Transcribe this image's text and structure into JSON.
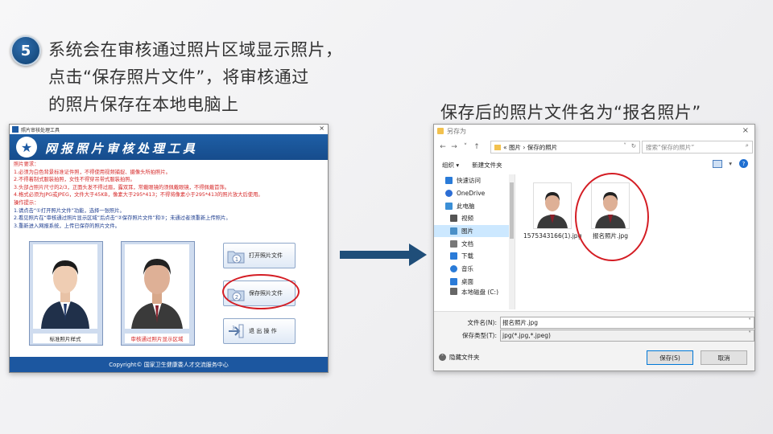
{
  "step": {
    "number": "5",
    "lines": [
      "系统会在审核通过照片区域显示照片，",
      "点击“保存照片文件”，将审核通过",
      "的照片保存在本地电脑上"
    ]
  },
  "caption_right": "保存后的照片文件名为“报名照片”",
  "tool_window": {
    "title": "照片审核处理工具",
    "close": "×",
    "banner_title": "网报照片审核处理工具",
    "requirements": [
      {
        "text": "照片要求：",
        "color": "red"
      },
      {
        "text": "1.必须为白色背景标准证件照，不得使用视频捕捉、摄像头所拍照片。",
        "color": "red"
      },
      {
        "text": "2.不得着制式服装拍照，女性不得穿吊带式服装拍照。",
        "color": "red"
      },
      {
        "text": "3.头部占照片尺寸的2/3，正面头发不得过眉，露双耳，常戴眼镜的须佩戴眼镜，不得佩戴首饰。",
        "color": "red"
      },
      {
        "text": "4.格式必须为JPG或JPEG，文件大于45KB，像素大于295*413；不得将像素小于295*413的照片放大后使用。",
        "color": "red"
      },
      {
        "text": "操作提示：",
        "color": "red"
      },
      {
        "text": "1.请点击“①打开照片文件”功能，选择一张照片。",
        "color": "blue"
      },
      {
        "text": "2.看见照片在“审核通过照片显示区域”后点击“②保存照片文件”和③；未通过者须重新上传照片。",
        "color": "blue"
      },
      {
        "text": "3.重新进入网报系统，上传已保存的照片文件。",
        "color": "blue"
      }
    ],
    "sample_caption": "标准照片样式",
    "approved_caption": "审核通过照片显示区域",
    "btn_open": "打开照片文件",
    "btn_save": "保存照片文件",
    "btn_exit": "退 出 操 作",
    "footer": "Copyright©  国家卫生健康委人才交流服务中心"
  },
  "dialog": {
    "title": "另存为",
    "close": "×",
    "path": [
      "«",
      "图片",
      "›",
      "保存的照片"
    ],
    "search_placeholder": "搜索“保存的照片”",
    "organize": "组织 ▾",
    "new_folder": "新建文件夹",
    "help": "?",
    "sidebar": [
      {
        "label": "快速访问",
        "icon": "star-icon",
        "color": "#2a7bd8"
      },
      {
        "label": "OneDrive",
        "icon": "cloud-icon",
        "color": "#2c6ed5"
      },
      {
        "label": "此电脑",
        "icon": "computer-icon",
        "color": "#3b8fd6"
      },
      {
        "label": "视频",
        "icon": "video-icon",
        "color": "#555555"
      },
      {
        "label": "图片",
        "icon": "pictures-icon",
        "color": "#4a90c8"
      },
      {
        "label": "文档",
        "icon": "document-icon",
        "color": "#777777"
      },
      {
        "label": "下载",
        "icon": "download-icon",
        "color": "#2a7bd8"
      },
      {
        "label": "音乐",
        "icon": "music-icon",
        "color": "#2a7bd8"
      },
      {
        "label": "桌面",
        "icon": "desktop-icon",
        "color": "#2a7bd8"
      },
      {
        "label": "本地磁盘 (C:)",
        "icon": "disk-icon",
        "color": "#666666"
      }
    ],
    "files": [
      {
        "name": "1575343166(1).jpg"
      },
      {
        "name": "报名照片.jpg"
      }
    ],
    "filename_label": "文件名(N):",
    "filename_value": "报名照片.jpg",
    "filetype_label": "保存类型(T):",
    "filetype_value": "jpg(*.jpg,*.jpeg)",
    "hide_folders": "隐藏文件夹",
    "save_button": "保存(S)",
    "cancel_button": "取消"
  },
  "colors": {
    "accent_blue": "#1c57a0",
    "highlight_red": "#d41d24",
    "arrow": "#1f4e79"
  }
}
